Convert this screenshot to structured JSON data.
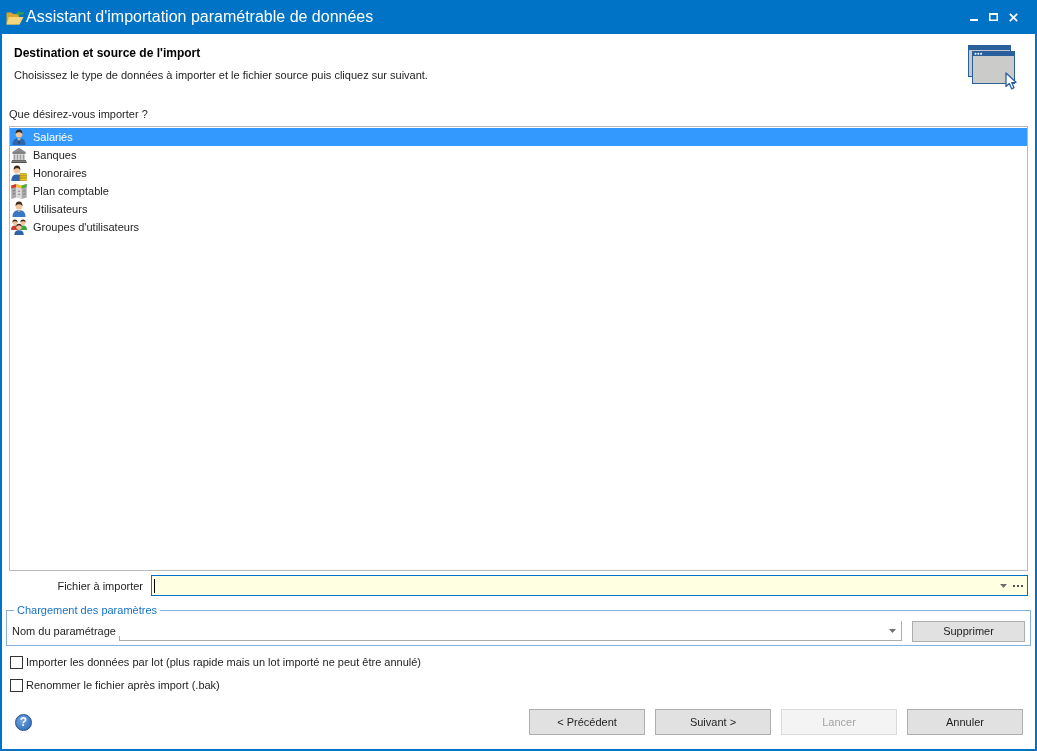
{
  "window": {
    "title": "Assistant d'importation paramétrable de données"
  },
  "header": {
    "title": "Destination et source de l'import",
    "subtitle": "Choisissez le type de données à importer et le fichier source puis cliquez sur suivant."
  },
  "import_list": {
    "label": "Que désirez-vous importer ?",
    "items": [
      {
        "label": "Salariés",
        "kind": "employee",
        "selected": true
      },
      {
        "label": "Banques",
        "kind": "bank",
        "selected": false
      },
      {
        "label": "Honoraires",
        "kind": "fee",
        "selected": false
      },
      {
        "label": "Plan comptable",
        "kind": "accounts",
        "selected": false
      },
      {
        "label": "Utilisateurs",
        "kind": "user",
        "selected": false
      },
      {
        "label": "Groupes d'utilisateurs",
        "kind": "group",
        "selected": false
      }
    ]
  },
  "file_field": {
    "label": "Fichier à importer",
    "focused": true
  },
  "settings_group": {
    "title": "Chargement des paramètres",
    "combo_label": "Nom du paramétrage",
    "button": "Supprimer"
  },
  "options": [
    {
      "label": "Importer les données par lot (plus rapide mais un lot importé ne peut être annulé)",
      "checked": false
    },
    {
      "label": "Renommer le fichier après import (.bak)",
      "checked": false
    }
  ],
  "help": {
    "symbol": "?"
  },
  "buttons": [
    {
      "label": "< Précédent",
      "disabled": false
    },
    {
      "label": "Suivant >",
      "disabled": false
    },
    {
      "label": "Lancer",
      "disabled": true
    },
    {
      "label": "Annuler",
      "disabled": false
    }
  ]
}
